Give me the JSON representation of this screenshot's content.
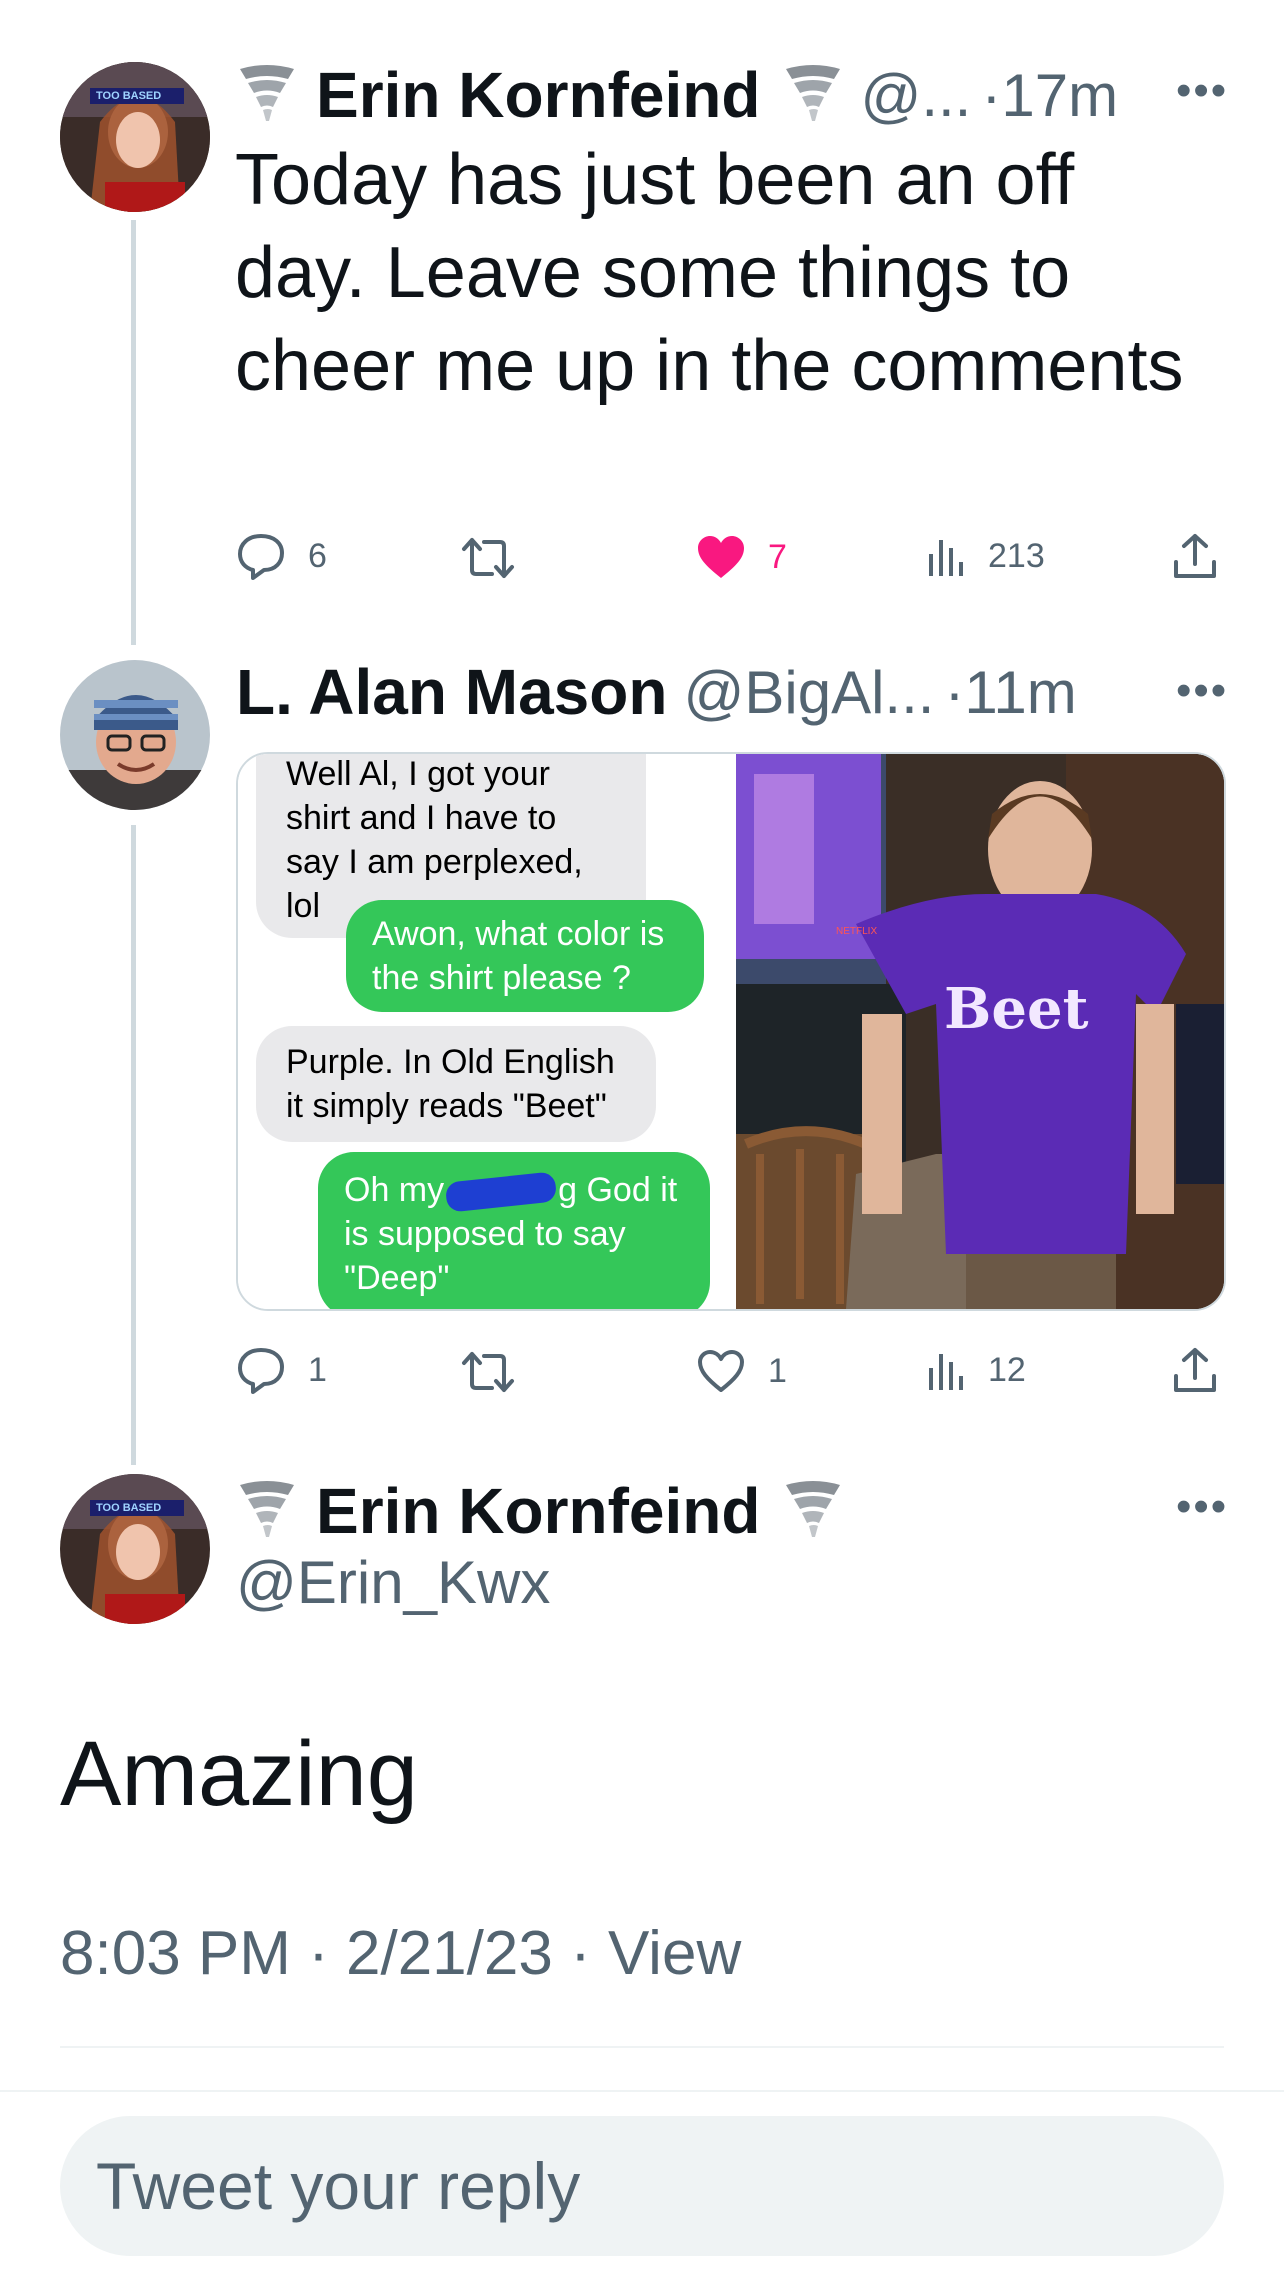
{
  "tweet1": {
    "name": "Erin Kornfeind",
    "emoji": "🌪",
    "handle": "@...",
    "time": "·17m",
    "text": "Today has just been an off day. Leave some things to cheer me up in the comments",
    "avatar_badge": "TOO BASED",
    "actions": {
      "replies": "6",
      "retweets": "",
      "likes": "7",
      "views": "213"
    }
  },
  "tweet2": {
    "name": "L. Alan Mason",
    "handle": "@BigAl...",
    "time": "·11m",
    "messages": [
      {
        "side": "left",
        "text": "Well Al, I got your shirt and I have to say I am perplexed, lol"
      },
      {
        "side": "right",
        "text": "Awon, what color is the shirt please ?"
      },
      {
        "side": "left",
        "text": "Purple. In Old English it simply reads \"Beet\""
      },
      {
        "side": "right",
        "text_a": "Oh my",
        "text_b": "g God it is supposed to say \"Deep\""
      }
    ],
    "shirt_text": "Beet",
    "tv_label": "NETFLIX",
    "actions": {
      "replies": "1",
      "retweets": "",
      "likes": "1",
      "views": "12"
    }
  },
  "main_tweet": {
    "name": "Erin Kornfeind",
    "handle": "@Erin_Kwx",
    "avatar_badge": "TOO BASED",
    "text": "Amazing",
    "timestamp": "8:03 PM · 2/21/23 · View"
  },
  "reply_box": {
    "placeholder": "Tweet your reply"
  },
  "colors": {
    "like_active": "#f91880",
    "muted": "#536471",
    "green": "#34c759",
    "grey_bubble": "#e9e9eb",
    "shirt": "#5b2bb5"
  }
}
